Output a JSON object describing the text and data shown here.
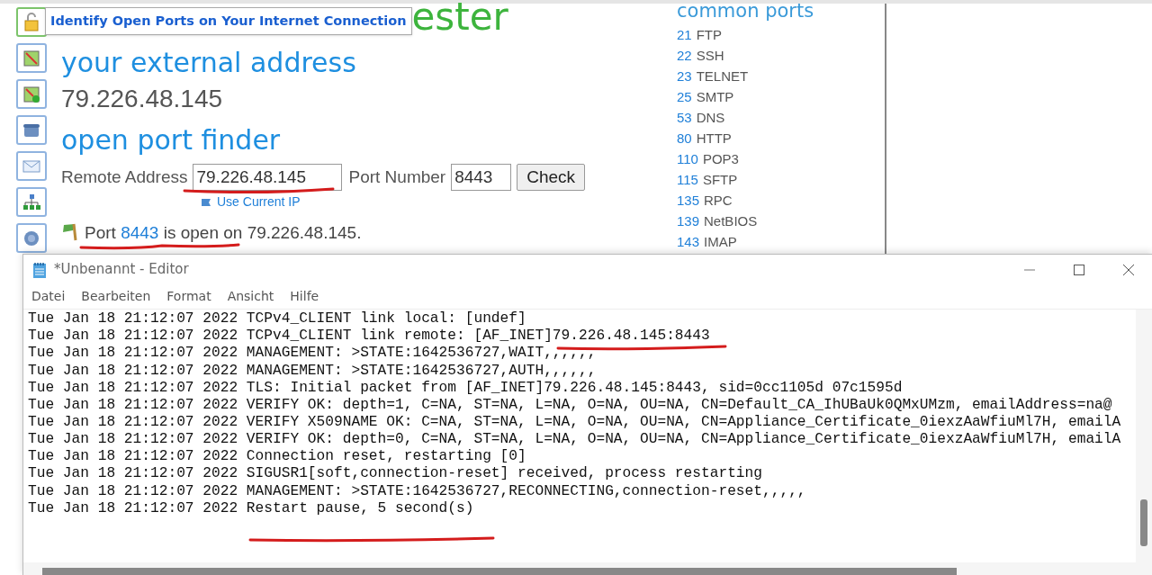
{
  "web_page": {
    "tooltip": "Identify Open Ports on Your Internet Connection",
    "title_fragment": "ester",
    "external_heading": "your external address",
    "external_ip": "79.226.48.145",
    "finder_heading": "open port finder",
    "form": {
      "remote_label": "Remote Address",
      "remote_value": "79.226.48.145",
      "port_label": "Port Number",
      "port_value": "8443",
      "button": "Check",
      "use_current_ip": "Use Current IP"
    },
    "result": {
      "before": "Port",
      "port": "8443",
      "after": "is open on 79.226.48.145."
    },
    "common_ports": {
      "title": "common ports",
      "items": [
        {
          "port": "21",
          "name": "FTP"
        },
        {
          "port": "22",
          "name": "SSH"
        },
        {
          "port": "23",
          "name": "TELNET"
        },
        {
          "port": "25",
          "name": "SMTP"
        },
        {
          "port": "53",
          "name": "DNS"
        },
        {
          "port": "80",
          "name": "HTTP"
        },
        {
          "port": "110",
          "name": "POP3"
        },
        {
          "port": "115",
          "name": "SFTP"
        },
        {
          "port": "135",
          "name": "RPC"
        },
        {
          "port": "139",
          "name": "NetBIOS"
        },
        {
          "port": "143",
          "name": "IMAP"
        }
      ]
    }
  },
  "editor": {
    "title": "*Unbenannt - Editor",
    "menu": [
      "Datei",
      "Bearbeiten",
      "Format",
      "Ansicht",
      "Hilfe"
    ],
    "lines": [
      "Tue Jan 18 21:12:07 2022 TCPv4_CLIENT link local: [undef]",
      "Tue Jan 18 21:12:07 2022 TCPv4_CLIENT link remote: [AF_INET]79.226.48.145:8443",
      "Tue Jan 18 21:12:07 2022 MANAGEMENT: >STATE:1642536727,WAIT,,,,,,",
      "Tue Jan 18 21:12:07 2022 MANAGEMENT: >STATE:1642536727,AUTH,,,,,,",
      "Tue Jan 18 21:12:07 2022 TLS: Initial packet from [AF_INET]79.226.48.145:8443, sid=0cc1105d 07c1595d",
      "Tue Jan 18 21:12:07 2022 VERIFY OK: depth=1, C=NA, ST=NA, L=NA, O=NA, OU=NA, CN=Default_CA_IhUBaUk0QMxUMzm, emailAddress=na@",
      "Tue Jan 18 21:12:07 2022 VERIFY X509NAME OK: C=NA, ST=NA, L=NA, O=NA, OU=NA, CN=Appliance_Certificate_0iexzAaWfiuMl7H, emailA",
      "Tue Jan 18 21:12:07 2022 VERIFY OK: depth=0, C=NA, ST=NA, L=NA, O=NA, OU=NA, CN=Appliance_Certificate_0iexzAaWfiuMl7H, emailA",
      "Tue Jan 18 21:12:07 2022 Connection reset, restarting [0]",
      "Tue Jan 18 21:12:07 2022 SIGUSR1[soft,connection-reset] received, process restarting",
      "Tue Jan 18 21:12:07 2022 MANAGEMENT: >STATE:1642536727,RECONNECTING,connection-reset,,,,,",
      "Tue Jan 18 21:12:07 2022 Restart pause, 5 second(s)"
    ]
  }
}
